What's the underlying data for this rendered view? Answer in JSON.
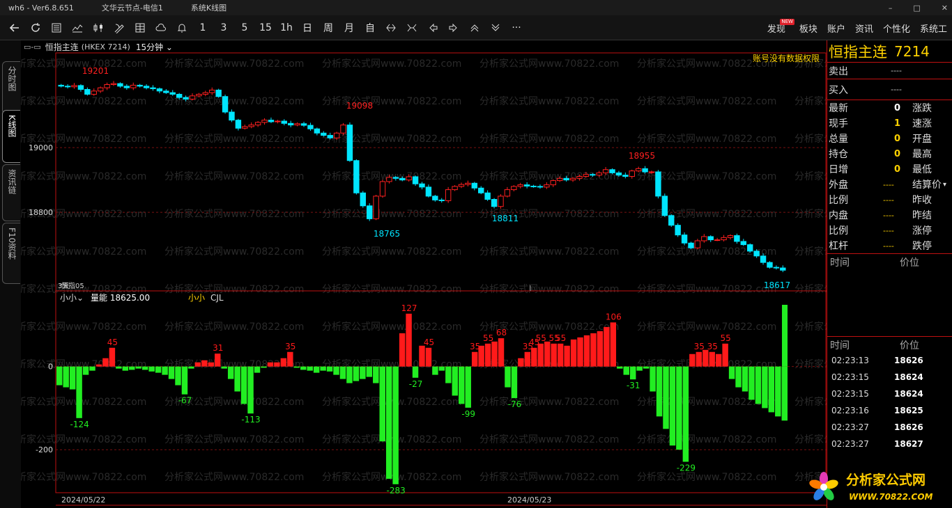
{
  "window": {
    "app": "wh6 - Ver6.8.651",
    "server": "文华云节点-电信1",
    "chart_mode": "系统K线图",
    "controls": [
      "–",
      "□",
      "✕"
    ]
  },
  "toolbar": {
    "icons": [
      "back-arrow-icon",
      "refresh-icon",
      "report-icon",
      "line-chart-icon",
      "kline-icon",
      "draw-tool-icon",
      "grid-icon",
      "cloud-icon",
      "bell-icon"
    ],
    "periods": [
      "1",
      "3",
      "5",
      "15",
      "1h",
      "日",
      "周",
      "月",
      "自"
    ],
    "nav_icons": [
      "zoom-in-icon",
      "zoom-out-icon",
      "left-arrow-icon",
      "right-arrow-icon",
      "up-arrow-icon",
      "down-arrow-icon",
      "more-icon"
    ],
    "more_glyph": "···",
    "right_menu": [
      "发现",
      "板块",
      "账户",
      "资讯",
      "个性化",
      "系统工"
    ],
    "new_badge": "NEW"
  },
  "left_tabs": [
    "分时图",
    "K线图",
    "资讯链",
    "F10资料"
  ],
  "chart": {
    "icon_text": "▭-▭",
    "name": "恒指主连",
    "code": "(HKEX 7214)",
    "period": "15分钟",
    "permission_notice": "账号没有数据权限",
    "watermark": "分析家公式网www.70822.com",
    "dates": [
      "2024/05/22",
      "2024/05/23"
    ],
    "sub_label_a": "3天",
    "sub_label_b": "恒指05",
    "indicator_selector": "小小",
    "indicator_value_label": "量能 18625.00",
    "indicator_name": "小小",
    "indicator_series": "CJL",
    "colors": {
      "up": "#ff2020",
      "down": "#00e5ff",
      "pos": "#ff1a1a",
      "neg": "#22ee22",
      "border": "#c01010"
    }
  },
  "chart_data": [
    {
      "type": "candlestick",
      "title": "恒指主连 (HKEX 7214) 15分钟",
      "y_ticks": [
        19000,
        18800
      ],
      "ylim": [
        18570,
        19280
      ],
      "annotations": {
        "high_1": 19201,
        "high_2": 19098,
        "high_3": 18955,
        "low_1": 18765,
        "low_2": 18811,
        "low_3": 18617
      },
      "closes": [
        19190,
        19188,
        19192,
        19180,
        19165,
        19175,
        19185,
        19195,
        19198,
        19190,
        19185,
        19193,
        19190,
        19185,
        19182,
        19175,
        19170,
        19165,
        19155,
        19150,
        19160,
        19165,
        19170,
        19178,
        19158,
        19110,
        19085,
        19060,
        19065,
        19070,
        19078,
        19085,
        19080,
        19082,
        19075,
        19070,
        19074,
        19069,
        19058,
        19045,
        19038,
        19030,
        19045,
        19070,
        18960,
        18860,
        18820,
        18780,
        18850,
        18895,
        18908,
        18905,
        18900,
        18910,
        18888,
        18878,
        18850,
        18838,
        18836,
        18870,
        18880,
        18886,
        18890,
        18875,
        18860,
        18840,
        18818,
        18850,
        18870,
        18880,
        18885,
        18881,
        18880,
        18878,
        18885,
        18898,
        18905,
        18900,
        18905,
        18911,
        18917,
        18915,
        18922,
        18932,
        18922,
        18915,
        18911,
        18928,
        18935,
        18925,
        18925,
        18850,
        18790,
        18760,
        18730,
        18705,
        18690,
        18712,
        18725,
        18715,
        18715,
        18722,
        18728,
        18710,
        18700,
        18680,
        18665,
        18645,
        18630,
        18628,
        18621
      ],
      "highs": [
        19201,
        19098,
        18955
      ],
      "lows": [
        18765,
        18811,
        18617
      ]
    },
    {
      "type": "bar",
      "title": "CJL",
      "series_name": "CJL",
      "y_ticks": [
        0,
        -200
      ],
      "ylim": [
        -300,
        145
      ],
      "labels": {
        "pos": [
          45,
          31,
          35,
          127,
          39,
          68,
          106,
          36,
          55
        ],
        "neg": [
          -124,
          -67,
          -113,
          -283,
          -27,
          -99,
          -76,
          -31,
          -229
        ]
      },
      "values": [
        -45,
        -50,
        -55,
        -124,
        -20,
        -10,
        5,
        20,
        45,
        -5,
        -10,
        -8,
        -5,
        -8,
        -12,
        -15,
        -20,
        -30,
        -45,
        -67,
        -5,
        10,
        15,
        10,
        31,
        -5,
        -30,
        -60,
        -90,
        -113,
        -15,
        -3,
        10,
        10,
        20,
        35,
        -3,
        -8,
        -10,
        -15,
        -10,
        -12,
        -20,
        -30,
        -40,
        -35,
        -30,
        -25,
        -40,
        -180,
        -270,
        -283,
        80,
        127,
        -27,
        50,
        45,
        -20,
        -10,
        -40,
        -70,
        -90,
        -99,
        35,
        50,
        55,
        60,
        68,
        -50,
        -76,
        20,
        35,
        45,
        55,
        60,
        55,
        55,
        50,
        65,
        70,
        75,
        80,
        85,
        95,
        106,
        -5,
        -20,
        -31,
        -10,
        -5,
        -60,
        -120,
        -150,
        -190,
        -200,
        -229,
        30,
        35,
        40,
        35,
        30,
        55,
        -30,
        -50,
        -60,
        -80,
        -90,
        -100,
        -110,
        -120,
        -130
      ]
    }
  ],
  "right_panel": {
    "name": "恒指主连",
    "code": "7214",
    "sell_label": "卖出",
    "sell_val": "----",
    "buy_label": "买入",
    "buy_val": "----",
    "rows": [
      {
        "l": "最新",
        "v": "0",
        "c": "#ffffff",
        "r": "涨跌"
      },
      {
        "l": "现手",
        "v": "1",
        "c": "#ffd200",
        "r": "速涨"
      },
      {
        "l": "总量",
        "v": "0",
        "c": "#ffd200",
        "r": "开盘"
      },
      {
        "l": "持仓",
        "v": "0",
        "c": "#ffd200",
        "r": "最高"
      },
      {
        "l": "日增",
        "v": "0",
        "c": "#ffd200",
        "r": "最低"
      },
      {
        "l": "外盘",
        "v": "----",
        "c": "#ffd200",
        "r": "结算价"
      },
      {
        "l": "比例",
        "v": "----",
        "c": "#ffd200",
        "r": "昨收"
      },
      {
        "l": "内盘",
        "v": "----",
        "c": "#ffd200",
        "r": "昨结"
      },
      {
        "l": "比例",
        "v": "----",
        "c": "#ffd200",
        "r": "涨停"
      },
      {
        "l": "杠杆",
        "v": "----",
        "c": "#ffd200",
        "r": "跌停"
      }
    ],
    "col_time": "时间",
    "col_price": "价位",
    "ticks": [
      {
        "t": "02:23:13",
        "p": "18626"
      },
      {
        "t": "02:23:15",
        "p": "18624"
      },
      {
        "t": "02:23:15",
        "p": "18624"
      },
      {
        "t": "02:23:16",
        "p": "18625"
      },
      {
        "t": "02:23:27",
        "p": "18626"
      },
      {
        "t": "02:23:27",
        "p": "18627"
      }
    ],
    "logo_text_1": "分析家公式网",
    "logo_text_2": "WWW.70822.COM"
  }
}
